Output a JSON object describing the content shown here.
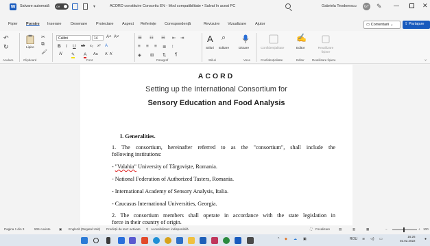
{
  "titlebar": {
    "app_icon": "word-icon",
    "autosave_label": "Salvare automată",
    "autosave_state": "Off",
    "document_title": "ACORD constituire Consortiu EN  -  Mod compatibilitate • Salvat în acest PC",
    "user_name": "Gabriela Teodorescu",
    "user_initials": "GT"
  },
  "menu": {
    "tabs": [
      "Fișier",
      "Pornire",
      "Inserare",
      "Desenare",
      "Proiectare",
      "Aspect",
      "Referințe",
      "Corespondență",
      "Revizuire",
      "Vizualizare",
      "Ajutor"
    ],
    "active": "Pornire",
    "comments_label": "Comentarii",
    "share_label": "Partajare"
  },
  "ribbon": {
    "paste_label": "Lipire",
    "font_name": "Calibri",
    "font_size": "14",
    "styles_label": "Stiluri",
    "editing_label": "Editare",
    "dictate_label": "Dictare",
    "sensitivity_label": "Confidențialitate",
    "editor_label": "Editor",
    "reuse_label": "Reutilizare fișiere",
    "group_labels": [
      "Anulare",
      "Clipboard",
      "Font",
      "Paragraf",
      "Stiluri",
      "Voce",
      "Confidențialitate",
      "Editor",
      "Reutilizare fișiere"
    ]
  },
  "document": {
    "title": "ACORD",
    "subtitle1": "Setting up the International Consortium for",
    "subtitle2": "Sensory Education and Food Analysis",
    "section_heading": "I.  Generalities.",
    "para1_line1": "1.  The  consortium,  hereinafter  referred  to  as  the  \"consortium\",  shall  include  the",
    "para1_line2": "following institutions:",
    "item1_prefix": "- ",
    "item1_squiggle": "\"Valahia\"",
    "item1_rest": " University of Târgoviște, Romania.",
    "item2": "- National Federation of Authorized Tasters, Romania.",
    "item3": "- International Academy of Sensory Analysis, Italia.",
    "item4": "- Caucasus International Universities, Georgia.",
    "para2_line1": "2.  The  consortium  members  shall  operate  in  accordance  with  the  state  legislation  in",
    "para2_line2": "force in their country of origin."
  },
  "statusbar": {
    "page": "Pagina 1 din 3",
    "words": "506 cuvinte",
    "language": "Engleză (Regatul Unit)",
    "text_predictions": "Predicții de text: activate",
    "accessibility": "Accesibilitate: indisponibilă",
    "focus": "Focalizare",
    "zoom": "100"
  },
  "taskbar": {
    "language": "ROU",
    "time": "16:26",
    "date": "02.02.2022"
  }
}
